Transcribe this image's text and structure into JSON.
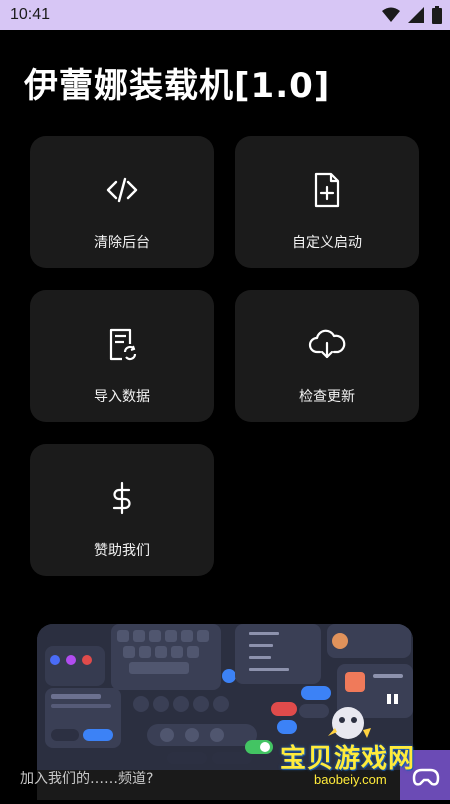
{
  "status_bar": {
    "time": "10:41",
    "icons": [
      "wifi-icon",
      "signal-icon",
      "battery-icon"
    ]
  },
  "app": {
    "title": "伊蕾娜装载机[1.0]"
  },
  "tiles": [
    {
      "label": "清除后台",
      "icon": "code-icon"
    },
    {
      "label": "自定义启动",
      "icon": "file-plus-icon"
    },
    {
      "label": "导入数据",
      "icon": "document-sync-icon"
    },
    {
      "label": "检查更新",
      "icon": "cloud-download-icon"
    },
    {
      "label": "赞助我们",
      "icon": "dollar-icon"
    }
  ],
  "banner": {
    "caption": "加入我们的……频道?"
  },
  "watermark": {
    "text": "宝贝游戏网",
    "url": "baobeiy.com"
  },
  "colors": {
    "background": "#000000",
    "tile": "#1b1b1b",
    "status_bar": "#d7c6f5"
  }
}
